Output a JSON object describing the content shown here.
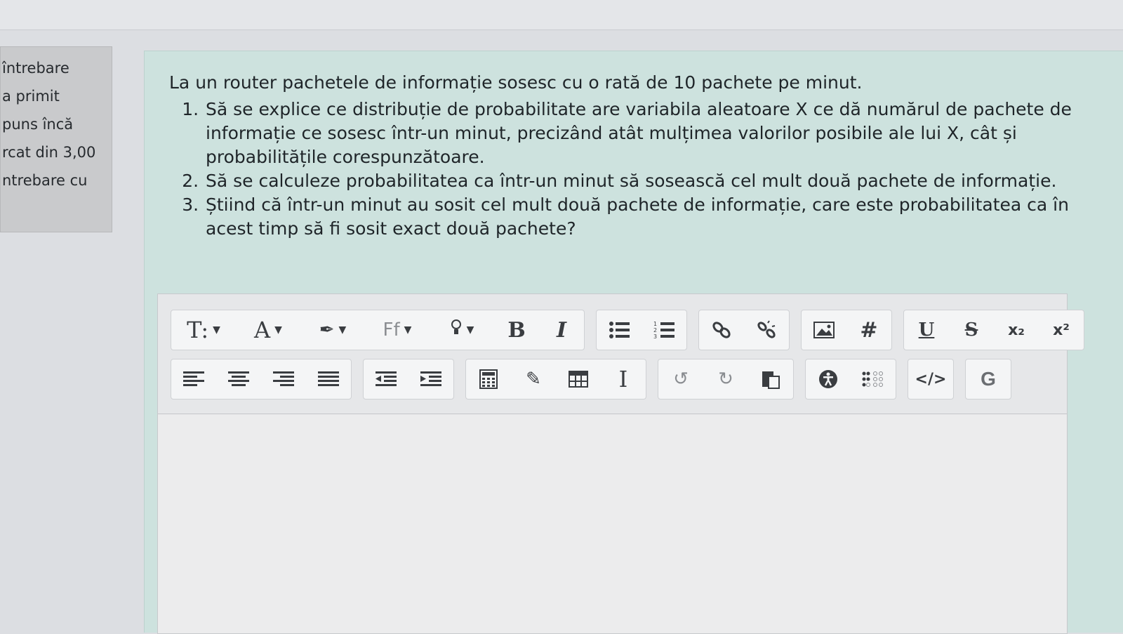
{
  "sidebar": {
    "lines": [
      "întrebare",
      " a primit",
      "puns încă",
      "rcat din 3,00",
      "ntrebare cu"
    ]
  },
  "question": {
    "intro": "La un router pachetele de informație sosesc cu o rată de 10 pachete pe minut.",
    "items": [
      "Să se explice ce distribuție de probabilitate are variabila aleatoare X ce dă numărul de pachete de informație ce sosesc într-un minut, precizând atât mulțimea valorilor posibile ale lui X, cât și probabilitățile corespunzătoare.",
      "Să se calculeze probabilitatea ca într-un minut să sosească cel mult două pachete de informație.",
      "Știind că într-un minut au sosit cel mult două pachete de informație, care este probabilitatea ca în acest timp să fi sosit exact două pachete?"
    ]
  },
  "toolbar": {
    "paragraph_format": "T:",
    "font_size": "A",
    "brush": "✒",
    "font_family": "Ff",
    "bulb": "❘",
    "bold": "B",
    "italic": "I",
    "bullet_list": "☰",
    "number_list": "≡",
    "link": "∞",
    "unlink": "✂",
    "image": "▣",
    "hashtag": "#",
    "underline": "U",
    "strikethrough": "S",
    "subscript": "x₂",
    "superscript": "x²",
    "align_left": "≡",
    "align_center": "≣",
    "align_right": "≡",
    "justify": "☰",
    "outdent": "⇤",
    "indent": "⇥",
    "calculator": "▦",
    "edit": "✎",
    "table": "▤",
    "cursor": "I",
    "undo": "↺",
    "redo": "↻",
    "paste": "■",
    "accessibility": "◉",
    "braille": "⠷",
    "code": "</>",
    "grammar": "G"
  }
}
